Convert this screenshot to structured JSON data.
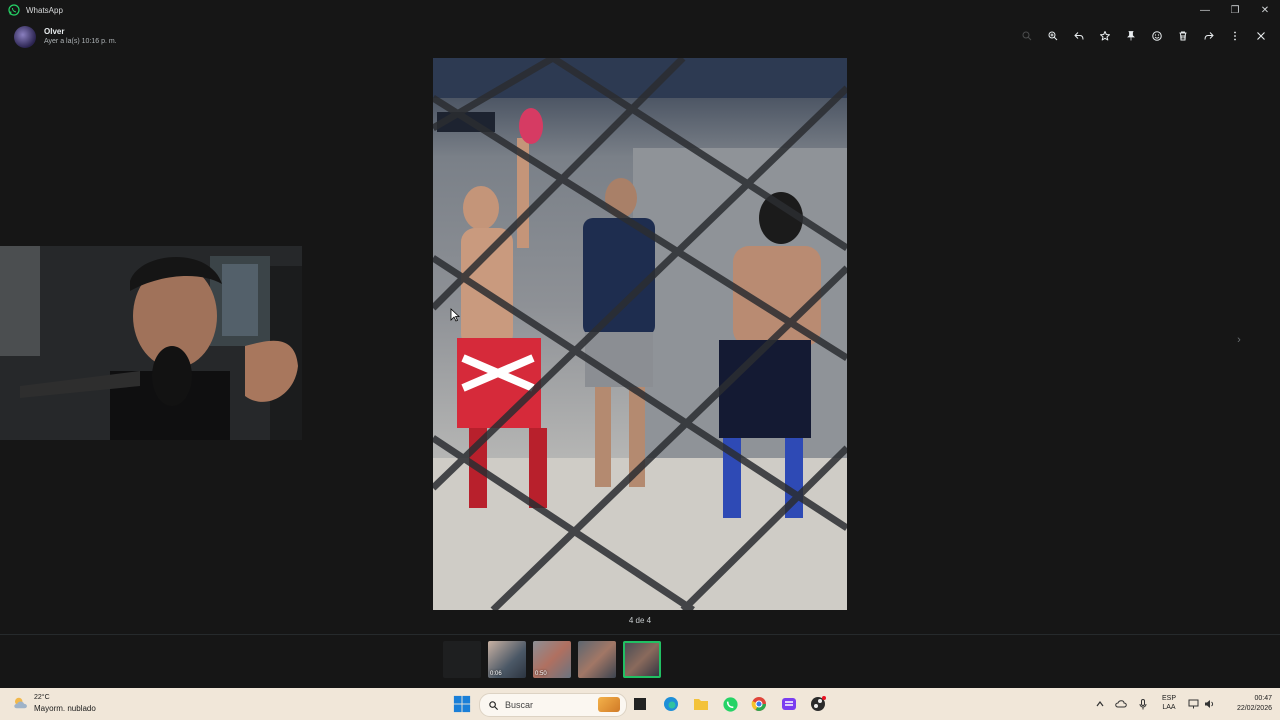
{
  "window": {
    "app_title": "WhatsApp",
    "controls": [
      "—",
      "❐",
      "✕"
    ]
  },
  "header": {
    "contact_name": "Olver",
    "last_seen": "Ayer a la(s) 10:16 p. m.",
    "toolbar_icons": [
      "zoom-in-icon",
      "reply-icon",
      "star-icon",
      "pin-icon",
      "emoji-icon",
      "delete-icon",
      "forward-icon",
      "more-icon",
      "close-icon"
    ]
  },
  "viewer": {
    "counter": "4 de 4",
    "next_arrow": "›"
  },
  "thumbnails": [
    {
      "duration": "",
      "active": false
    },
    {
      "duration": "0:06",
      "active": false
    },
    {
      "duration": "0:50",
      "active": false
    },
    {
      "duration": "",
      "active": false
    },
    {
      "duration": "",
      "active": true
    }
  ],
  "taskbar": {
    "weather_temp": "22°C",
    "weather_desc": "Mayorm. nublado",
    "search_placeholder": "Buscar",
    "lang_line1": "ESP",
    "lang_line2": "LAA",
    "time": "00:47",
    "date": "22/02/2026"
  },
  "colors": {
    "background": "#161616",
    "accent": "#21c063",
    "taskbar": "#f1e7d9"
  }
}
